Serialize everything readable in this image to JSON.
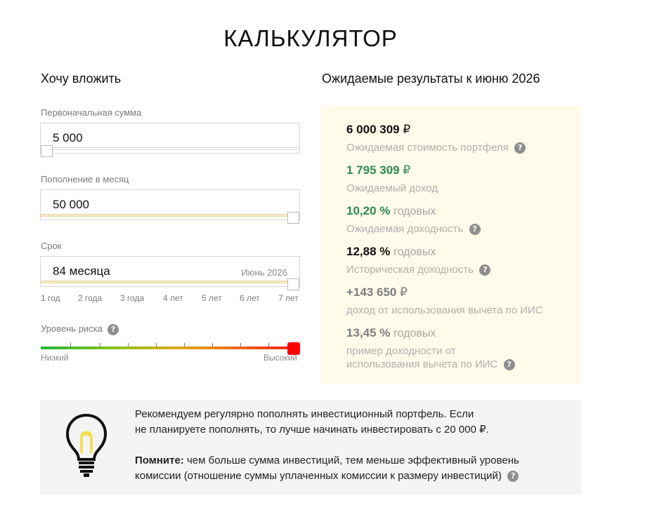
{
  "page": {
    "title": "КАЛЬКУЛЯТОР"
  },
  "left": {
    "heading": "Хочу вложить",
    "initial": {
      "label": "Первоначальная сумма",
      "value": "5 000",
      "fill": 0.0
    },
    "monthly": {
      "label": "Пополнение в месяц",
      "value": "50 000",
      "fill": 1.0
    },
    "term": {
      "label": "Срок",
      "value": "84 месяца",
      "hint": "Июнь 2026",
      "fill": 1.0,
      "ticks": [
        "1 год",
        "2 года",
        "3 года",
        "4 лет",
        "5 лет",
        "6 лет",
        "7 лет"
      ]
    },
    "risk": {
      "label": "Уровень риска",
      "help": "?",
      "low": "Низкий",
      "high": "Высокий",
      "level": 1.0
    }
  },
  "right": {
    "heading": "Ожидаемые результаты к июню 2026",
    "portfolio": {
      "value": "6 000 309",
      "unit": "₽",
      "desc": "Ожидаемая стоимость портфеля",
      "help": "?"
    },
    "income": {
      "value": "1 795 309",
      "unit": "₽",
      "desc": "Ожидаемый доход"
    },
    "expected_yield": {
      "value": "10,20 %",
      "suffix": "годовых",
      "desc": "Ожидаемая доходность",
      "help": "?"
    },
    "historical_yield": {
      "value": "12,88 %",
      "suffix": "годовых",
      "desc": "Историческая доходность",
      "help": "?"
    },
    "iis_deduction": {
      "value": "+143 650",
      "unit": "₽",
      "desc": "доход от использования вычета по ИИС"
    },
    "iis_yield": {
      "value": "13,45 %",
      "suffix": "годовых",
      "desc_line1": "пример доходности от",
      "desc_line2": "использования вычета по ИИС",
      "help": "?"
    }
  },
  "tip": {
    "line1": "Рекомендуем регулярно пополнять инвестиционный портфель. Если",
    "line2": "не планируете пополнять, то лучше начинать инвестировать с 20 000 ₽.",
    "remember_label": "Помните:",
    "remember_rest": " чем больше сумма инвестиций, тем меньше эффективный уровень",
    "line4": "комиссии (отношение суммы уплаченных комиссии к размеру инвестиций)",
    "help": "?"
  },
  "colors": {
    "green": "#2b8a55",
    "results_bg": "#fefbea",
    "tip_bg": "#f4f4f4",
    "risk_thumb": "#ff0000"
  }
}
